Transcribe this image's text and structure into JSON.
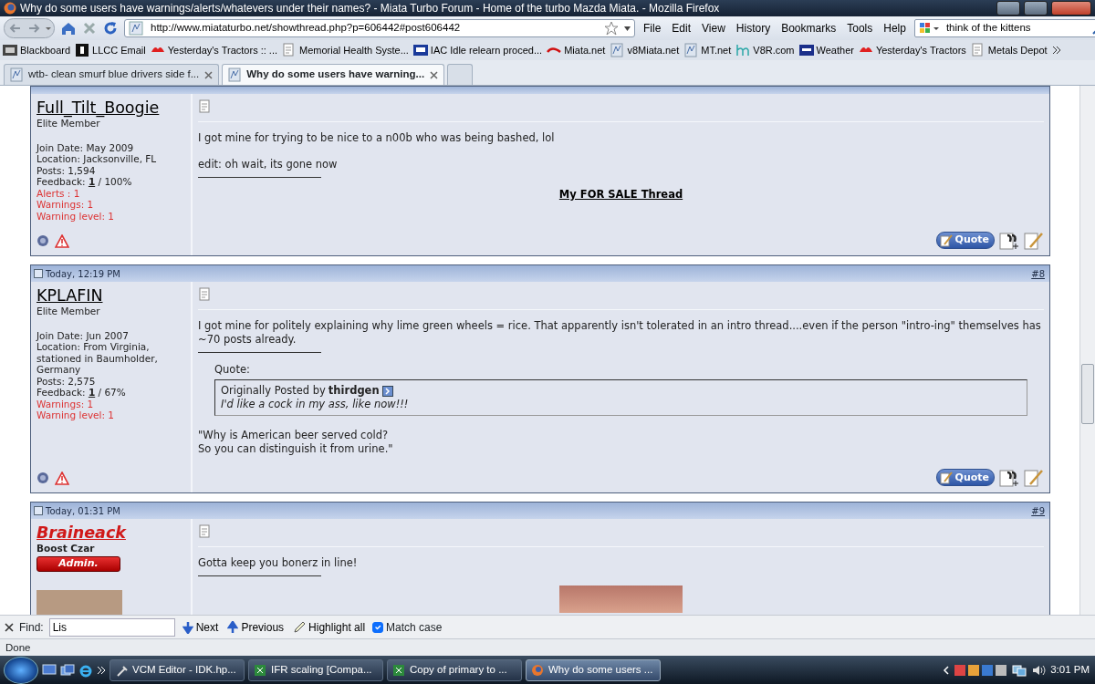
{
  "window": {
    "title": "Why do some users have warnings/alerts/whatevers under their names? - Miata Turbo Forum - Home of the turbo Mazda Miata. - Mozilla Firefox"
  },
  "menu": [
    "File",
    "Edit",
    "View",
    "History",
    "Bookmarks",
    "Tools",
    "Help"
  ],
  "address": {
    "url": "http://www.miataturbo.net/showthread.php?p=606442#post606442"
  },
  "search": {
    "value": "think of the kittens"
  },
  "bookmarks": [
    {
      "label": "Blackboard"
    },
    {
      "label": "LLCC Email"
    },
    {
      "label": "Yesterday's Tractors :: ..."
    },
    {
      "label": "Memorial Health Syste..."
    },
    {
      "label": "IAC Idle relearn proced..."
    },
    {
      "label": "Miata.net"
    },
    {
      "label": "v8Miata.net"
    },
    {
      "label": "MT.net"
    },
    {
      "label": "V8R.com"
    },
    {
      "label": "Weather"
    },
    {
      "label": "Yesterday's Tractors"
    },
    {
      "label": "Metals Depot"
    }
  ],
  "tabs": [
    {
      "label": "wtb- clean smurf blue drivers side f...",
      "selected": false
    },
    {
      "label": "Why do some users have warning...",
      "selected": true
    }
  ],
  "posts": [
    {
      "cut_header": true,
      "username": "Full_Tilt_Boogie",
      "kind": "member",
      "rank": "Elite Member",
      "details": [
        {
          "kind": "plain",
          "text": "Join Date: May 2009"
        },
        {
          "kind": "plain",
          "text": "Location: Jacksonville, FL"
        },
        {
          "kind": "plain",
          "text": "Posts: 1,594"
        },
        {
          "kind": "plain",
          "text": "Feedback: **1** / 100%"
        },
        {
          "kind": "warning",
          "text": "Alerts : 1"
        },
        {
          "kind": "warning",
          "text": "Warnings: 1"
        },
        {
          "kind": "warning",
          "text": "Warning level: 1"
        }
      ],
      "body": [
        {
          "kind": "text",
          "text": "I got mine for trying to be nice to a n00b who was being bashed, lol"
        },
        {
          "kind": "text",
          "text": "edit: oh wait, its gone now"
        },
        {
          "kind": "rule"
        },
        {
          "kind": "link",
          "text": "My FOR SALE Thread"
        }
      ],
      "quote_button": "Quote"
    },
    {
      "cut_header": false,
      "time": "Today, 12:19 PM",
      "number": "#8",
      "username": "KPLAFIN",
      "kind": "member",
      "rank": "Elite Member",
      "details": [
        {
          "kind": "plain",
          "text": "Join Date: Jun 2007"
        },
        {
          "kind": "plain",
          "text": "Location: From Virginia, stationed in Baumholder, Germany"
        },
        {
          "kind": "plain",
          "text": "Posts: 2,575"
        },
        {
          "kind": "plain",
          "text": "Feedback: **1** / 67%"
        },
        {
          "kind": "warning",
          "text": "Warnings: 1"
        },
        {
          "kind": "warning",
          "text": "Warning level: 1"
        }
      ],
      "body": [
        {
          "kind": "text",
          "text": "I got mine for politely explaining why lime green wheels = rice. That apparently isn't tolerated in an intro thread....even if the person \"intro-ing\" themselves has ~70 posts already."
        },
        {
          "kind": "rule"
        },
        {
          "kind": "quote",
          "label": "Quote:",
          "prefix": "Originally Posted by",
          "author": "thirdgen",
          "text": "I'd like a cock in my ass, like now!!!"
        },
        {
          "kind": "text",
          "text": "\"Why is American beer served cold?\nSo you can distinguish it from urine.\""
        }
      ],
      "quote_button": "Quote"
    },
    {
      "cut_header": false,
      "time": "Today, 01:31 PM",
      "number": "#9",
      "username": "Braineack",
      "kind": "admin",
      "rank": "Boost Czar",
      "badge": "Admin.",
      "body": [
        {
          "kind": "text",
          "text": "Gotta keep you bonerz in line!"
        },
        {
          "kind": "rule"
        },
        {
          "kind": "photo"
        }
      ]
    }
  ],
  "find_bar": {
    "label": "Find:",
    "value": "Lis",
    "next": "Next",
    "previous": "Previous",
    "highlight": "Highlight all",
    "match_case": {
      "label": "Match case",
      "checked": true
    }
  },
  "status_bar": {
    "text": "Done"
  },
  "taskbar": {
    "tasks": [
      {
        "label": "VCM Editor - IDK.hp...",
        "selected": false
      },
      {
        "label": "IFR scaling  [Compa...",
        "selected": false
      },
      {
        "label": "Copy of primary to ...",
        "selected": false
      },
      {
        "label": "Why do some users ...",
        "selected": true
      }
    ],
    "clock": "3:01 PM"
  }
}
